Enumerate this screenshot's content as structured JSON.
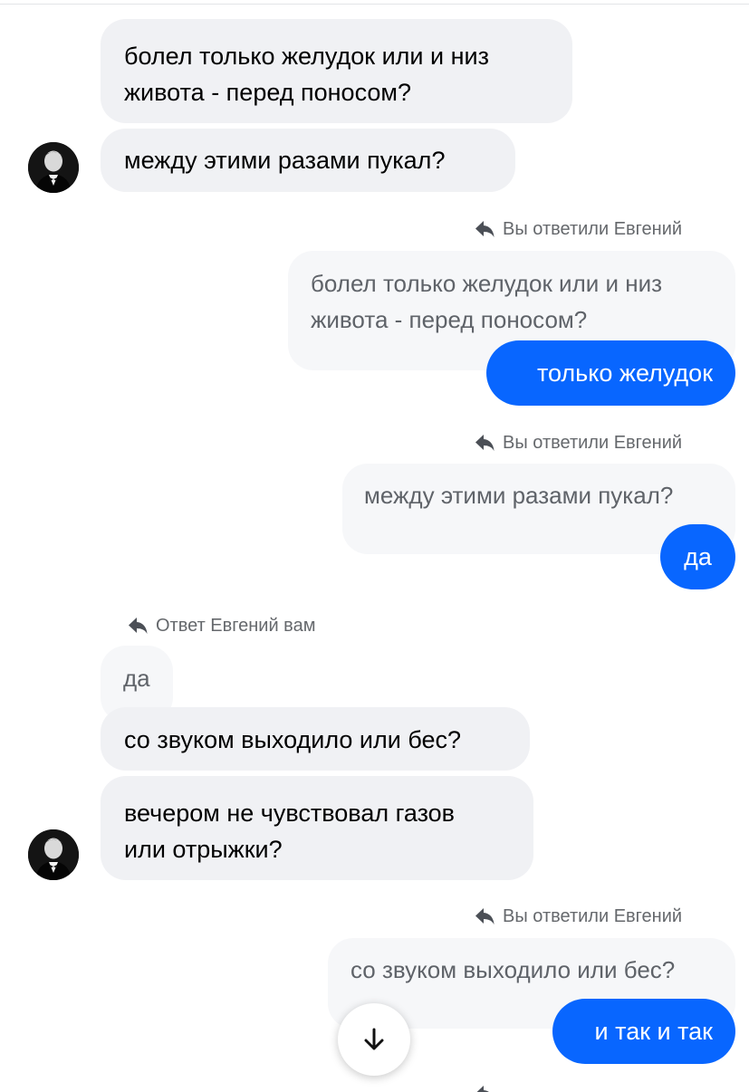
{
  "conversation": {
    "contact_name": "Евгений",
    "messages": [
      {
        "id": "m1",
        "sender": "contact",
        "text": "болел только желудок или и низ\nживота - перед поносом?"
      },
      {
        "id": "m2",
        "sender": "contact",
        "text": "между этими разами пукал?"
      },
      {
        "id": "m3",
        "sender": "me",
        "reply_label": "Вы ответили Евгений",
        "quoted": "болел только желудок или и низ\nживота - перед поносом?",
        "text": "только желудок"
      },
      {
        "id": "m4",
        "sender": "me",
        "reply_label": "Вы ответили Евгений",
        "quoted": "между этими разами пукал?",
        "text": "да"
      },
      {
        "id": "m5",
        "sender": "contact",
        "reply_label": "Ответ Евгений вам",
        "quoted": "да",
        "text": "со звуком выходило или бес?"
      },
      {
        "id": "m6",
        "sender": "contact",
        "text": "вечером не чувствовал газов\nили отрыжки?"
      },
      {
        "id": "m7",
        "sender": "me",
        "reply_label": "Вы ответили Евгений",
        "quoted": "со звуком выходило или бес?",
        "text": "и так и так"
      }
    ]
  },
  "icons": {
    "reply": "reply-arrow-icon",
    "scroll": "arrow-down-icon",
    "avatar": "contact-avatar"
  },
  "colors": {
    "outgoing_bubble": "#0866ff",
    "incoming_bubble": "#f0f1f4",
    "quoted_bubble": "#f6f7f9",
    "meta_text": "#65686c"
  }
}
